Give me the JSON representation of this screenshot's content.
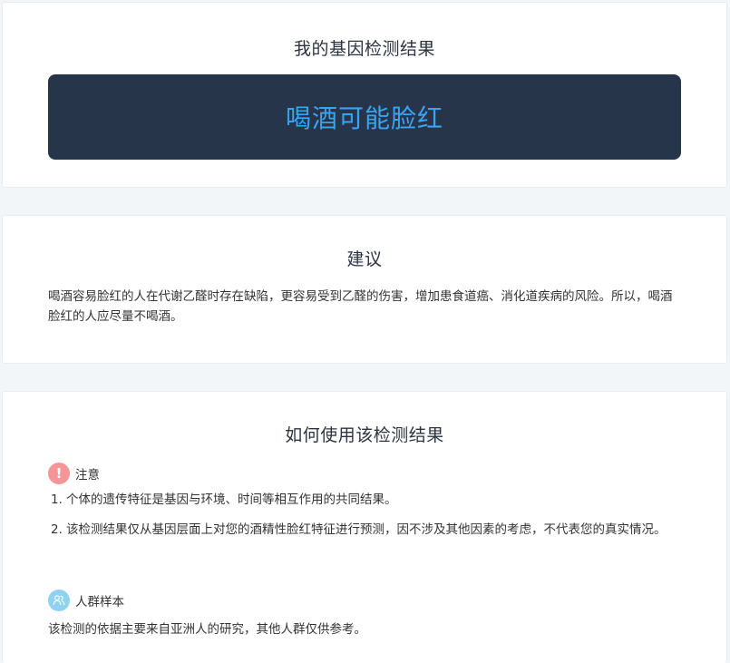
{
  "result_card": {
    "title": "我的基因检测结果",
    "result": "喝酒可能脸红"
  },
  "advice_card": {
    "title": "建议",
    "text": "喝酒容易脸红的人在代谢乙醛时存在缺陷，更容易受到乙醛的伤害，增加患食道癌、消化道疾病的风险。所以，喝酒脸红的人应尽量不喝酒。"
  },
  "usage_card": {
    "title": "如何使用该检测结果",
    "notice": {
      "icon": "exclamation-icon",
      "icon_glyph": "!",
      "label": "注意",
      "items": [
        {
          "num": "1.",
          "text": "个体的遗传特征是基因与环境、时间等相互作用的共同结果。"
        },
        {
          "num": "2.",
          "text": "该检测结果仅从基因层面上对您的酒精性脸红特征进行预测，因不涉及其他因素的考虑，不代表您的真实情况。"
        }
      ]
    },
    "sample": {
      "icon": "people-icon",
      "label": "人群样本",
      "text": "该检测的依据主要来自亚洲人的研究，其他人群仅供参考。"
    }
  },
  "colors": {
    "page_bg": "#f3f6f9",
    "banner_bg": "#26354a",
    "result_text": "#3aa3f2",
    "warn_icon_bg": "#f59597",
    "people_icon_bg": "#8fd2f1"
  }
}
